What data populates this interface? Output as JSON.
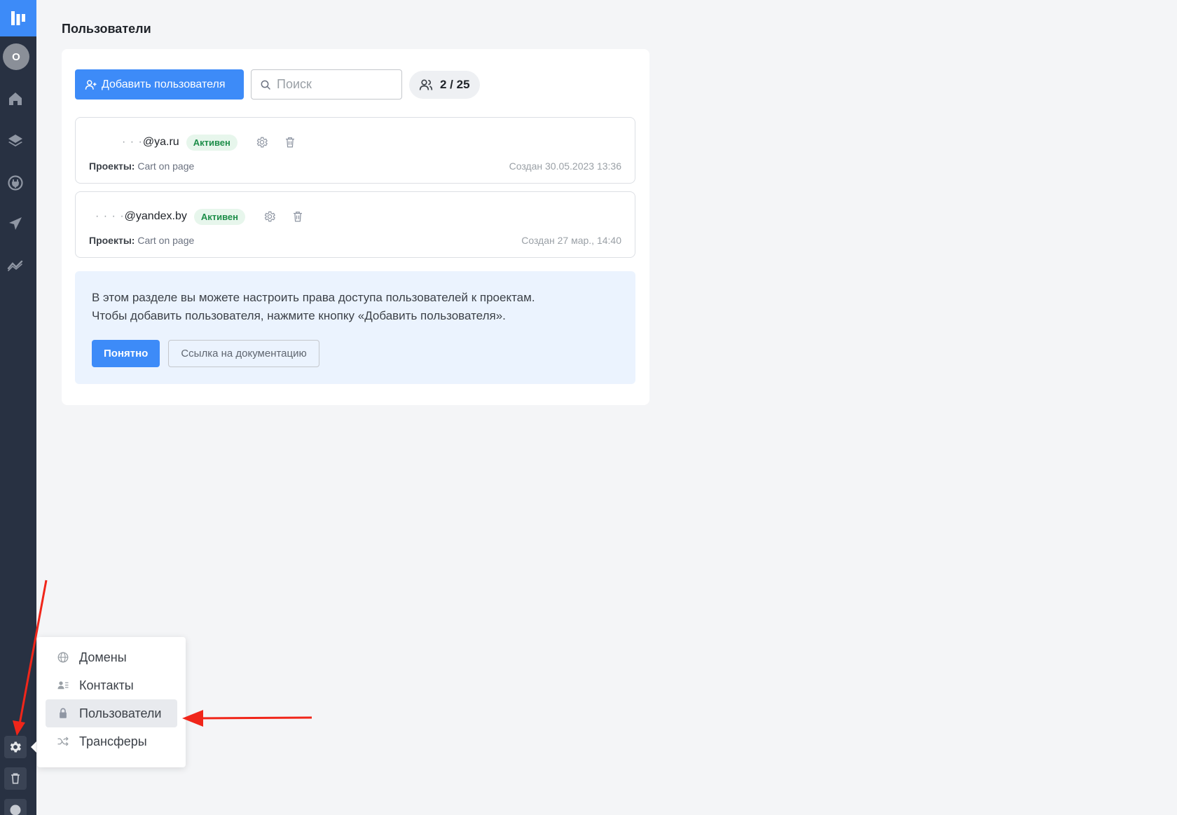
{
  "page": {
    "title": "Пользователи"
  },
  "sidebar": {
    "avatar_letter": "O",
    "icons": [
      "home-icon",
      "layers-icon",
      "plug-icon",
      "send-icon",
      "analytics-icon"
    ],
    "bottom": [
      "gear-icon",
      "trash-icon",
      "help-icon"
    ]
  },
  "toolbar": {
    "add_label": "Добавить пользователя",
    "search_placeholder": "Поиск",
    "counter": "2 / 25"
  },
  "users": [
    {
      "email_masked": "· ·  ·",
      "email_domain": "@ya.ru",
      "status": "Активен",
      "projects_label": "Проекты:",
      "projects": "Cart on page",
      "created": "Создан 30.05.2023 13:36"
    },
    {
      "email_masked": "·  ·  ·  ·",
      "email_domain": "@yandex.by",
      "status": "Активен",
      "projects_label": "Проекты:",
      "projects": "Cart on page",
      "created": "Создан 27 мар., 14:40"
    }
  ],
  "info": {
    "line1": "В этом разделе вы можете настроить права доступа пользователей к проектам.",
    "line2": "Чтобы добавить пользователя, нажмите кнопку «Добавить пользователя».",
    "ok_label": "Понятно",
    "doc_label": "Ссылка на документацию"
  },
  "settings_menu": {
    "items": [
      {
        "label": "Домены",
        "icon": "globe-icon"
      },
      {
        "label": "Контакты",
        "icon": "contacts-icon"
      },
      {
        "label": "Пользователи",
        "icon": "lock-icon",
        "active": true
      },
      {
        "label": "Трансферы",
        "icon": "shuffle-icon"
      }
    ]
  },
  "colors": {
    "sidebar": "#283142",
    "accent": "#3d8bf8",
    "annotation": "#f0261a",
    "status_active": "#1e8e4a"
  }
}
